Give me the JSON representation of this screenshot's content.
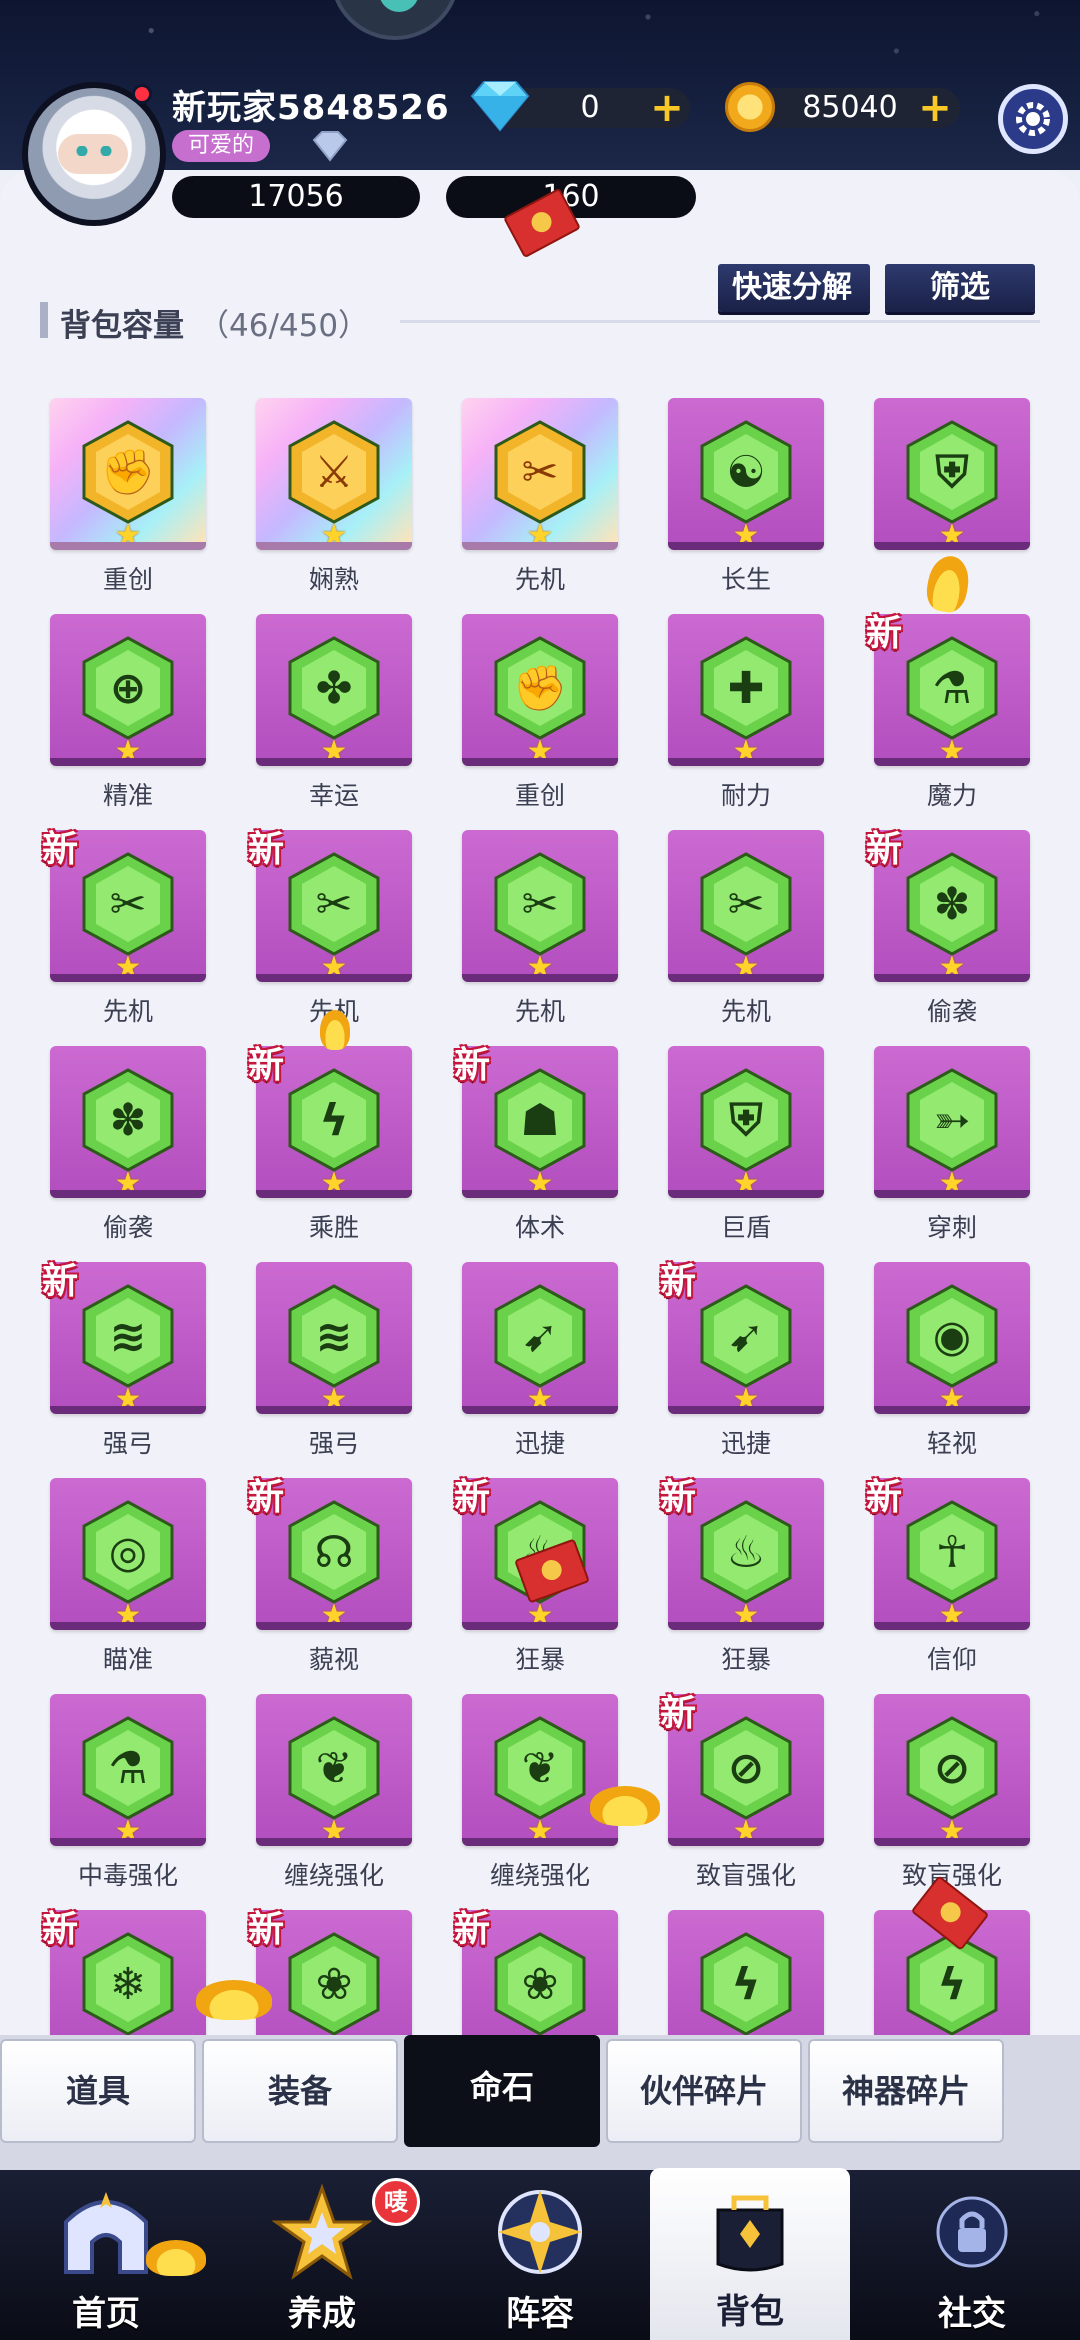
{
  "player": {
    "name": "新玩家5848526",
    "tag": "可爱的",
    "power": "17056",
    "stars": "160"
  },
  "currency": {
    "gems": "0",
    "gold": "85040"
  },
  "inventory": {
    "capacity_label": "背包容量",
    "capacity_count": "（46/450）",
    "btn_decompose": "快速分解",
    "btn_filter": "筛选"
  },
  "items": [
    {
      "label": "重创",
      "new": false,
      "tier": "gold",
      "glyph": "fist-icon"
    },
    {
      "label": "娴熟",
      "new": false,
      "tier": "gold",
      "glyph": "sword-icon"
    },
    {
      "label": "先机",
      "new": false,
      "tier": "gold",
      "glyph": "swords-icon"
    },
    {
      "label": "长生",
      "new": false,
      "tier": "purple",
      "glyph": "yinyang-icon"
    },
    {
      "label": "",
      "new": false,
      "tier": "purple",
      "glyph": "shield-icon"
    },
    {
      "label": "精准",
      "new": false,
      "tier": "purple",
      "glyph": "crosshair-icon"
    },
    {
      "label": "幸运",
      "new": false,
      "tier": "purple",
      "glyph": "clover-icon"
    },
    {
      "label": "重创",
      "new": false,
      "tier": "purple",
      "glyph": "fist-icon"
    },
    {
      "label": "耐力",
      "new": false,
      "tier": "purple",
      "glyph": "medic-shield-icon"
    },
    {
      "label": "魔力",
      "new": true,
      "tier": "purple",
      "glyph": "potion-icon"
    },
    {
      "label": "先机",
      "new": true,
      "tier": "purple",
      "glyph": "swords-icon"
    },
    {
      "label": "先机",
      "new": true,
      "tier": "purple",
      "glyph": "swords-icon"
    },
    {
      "label": "先机",
      "new": false,
      "tier": "purple",
      "glyph": "swords-icon"
    },
    {
      "label": "先机",
      "new": false,
      "tier": "purple",
      "glyph": "swords-icon"
    },
    {
      "label": "偷袭",
      "new": true,
      "tier": "purple",
      "glyph": "paw-icon"
    },
    {
      "label": "偷袭",
      "new": false,
      "tier": "purple",
      "glyph": "paw-icon"
    },
    {
      "label": "乘胜",
      "new": true,
      "tier": "purple",
      "glyph": "lightning-icon"
    },
    {
      "label": "体术",
      "new": true,
      "tier": "purple",
      "glyph": "arm-icon"
    },
    {
      "label": "巨盾",
      "new": false,
      "tier": "purple",
      "glyph": "shield-icon"
    },
    {
      "label": "穿刺",
      "new": false,
      "tier": "purple",
      "glyph": "arrow-icon"
    },
    {
      "label": "强弓",
      "new": true,
      "tier": "purple",
      "glyph": "arrows-icon"
    },
    {
      "label": "强弓",
      "new": false,
      "tier": "purple",
      "glyph": "arrows-icon"
    },
    {
      "label": "迅捷",
      "new": false,
      "tier": "purple",
      "glyph": "speed-icon"
    },
    {
      "label": "迅捷",
      "new": true,
      "tier": "purple",
      "glyph": "speed-icon"
    },
    {
      "label": "轻视",
      "new": false,
      "tier": "purple",
      "glyph": "eye-shield-icon"
    },
    {
      "label": "瞄准",
      "new": false,
      "tier": "purple",
      "glyph": "target-icon"
    },
    {
      "label": "藐视",
      "new": true,
      "tier": "purple",
      "glyph": "mask-icon"
    },
    {
      "label": "狂暴",
      "new": true,
      "tier": "purple",
      "glyph": "flame-icon"
    },
    {
      "label": "狂暴",
      "new": true,
      "tier": "purple",
      "glyph": "flame-icon"
    },
    {
      "label": "信仰",
      "new": true,
      "tier": "purple",
      "glyph": "angel-icon"
    },
    {
      "label": "中毒强化",
      "new": false,
      "tier": "purple",
      "glyph": "flask-icon"
    },
    {
      "label": "缠绕强化",
      "new": false,
      "tier": "purple",
      "glyph": "vine-icon"
    },
    {
      "label": "缠绕强化",
      "new": false,
      "tier": "purple",
      "glyph": "vine-icon"
    },
    {
      "label": "致盲强化",
      "new": true,
      "tier": "purple",
      "glyph": "blind-icon"
    },
    {
      "label": "致盲强化",
      "new": false,
      "tier": "purple",
      "glyph": "blind-icon"
    },
    {
      "label": "",
      "new": true,
      "tier": "purple",
      "glyph": "snowflake-icon"
    },
    {
      "label": "",
      "new": true,
      "tier": "purple",
      "glyph": "sprout-icon"
    },
    {
      "label": "",
      "new": true,
      "tier": "purple",
      "glyph": "sprout-icon"
    },
    {
      "label": "",
      "new": false,
      "tier": "purple",
      "glyph": "bolt-drop-icon"
    },
    {
      "label": "",
      "new": false,
      "tier": "purple",
      "glyph": "bolt-drop-icon"
    }
  ],
  "new_label": "新",
  "star_glyph": "★",
  "subtabs": [
    "道具",
    "装备",
    "命石",
    "伙伴碎片",
    "神器碎片"
  ],
  "active_subtab": 2,
  "nav": {
    "home": "首页",
    "develop": "养成",
    "lineup": "阵容",
    "bag": "背包",
    "social": "社交",
    "develop_badge": "唛"
  },
  "colors": {
    "card_purple": "#c05ec8",
    "hex_green": "#6ad24a",
    "hex_gold": "#f2b52a",
    "new_red": "#c4173d"
  }
}
